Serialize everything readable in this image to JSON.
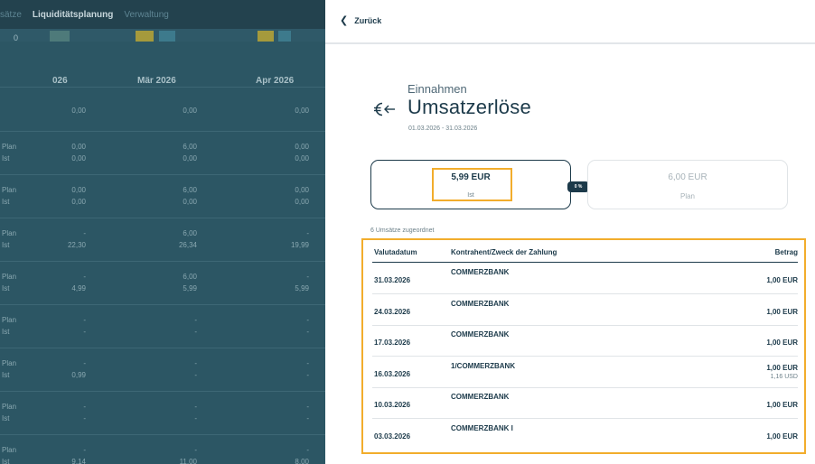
{
  "left": {
    "tabs": [
      "sätze",
      "Liquiditätsplanung",
      "Verwaltung"
    ],
    "active_tab": "Liquiditätsplanung",
    "zero_label": "0",
    "months": [
      "026",
      "Mär 2026",
      "Apr 2026"
    ],
    "first_row": [
      "0,00",
      "0,00",
      "0,00"
    ],
    "groups": [
      {
        "plan": [
          "0,00",
          "6,00",
          "0,00"
        ],
        "ist": [
          "0,00",
          "0,00",
          "0,00"
        ]
      },
      {
        "plan": [
          "0,00",
          "6,00",
          "0,00"
        ],
        "ist": [
          "0,00",
          "0,00",
          "0,00"
        ]
      },
      {
        "plan": [
          "-",
          "6,00",
          "-"
        ],
        "ist": [
          "22,30",
          "26,34",
          "19,99"
        ]
      },
      {
        "plan": [
          "-",
          "6,00",
          "-"
        ],
        "ist": [
          "4,99",
          "5,99",
          "5,99"
        ]
      },
      {
        "plan": [
          "-",
          "-",
          "-"
        ],
        "ist": [
          "-",
          "-",
          "-"
        ]
      },
      {
        "plan": [
          "-",
          "-",
          "-"
        ],
        "ist": [
          "0,99",
          "-",
          "-"
        ]
      },
      {
        "plan": [
          "-",
          "-",
          "-"
        ],
        "ist": [
          "-",
          "-",
          "-"
        ]
      },
      {
        "plan": [
          "-",
          "-",
          "-"
        ],
        "ist": [
          "9,14",
          "11,00",
          "8,00"
        ]
      }
    ],
    "plan_label": "Plan",
    "ist_label": "Ist"
  },
  "panel": {
    "back_label": "Zurück",
    "category": "Einnahmen",
    "title": "Umsatzerlöse",
    "date_range": "01.03.2026 - 31.03.2026",
    "ist_card": {
      "amount": "5,99 EUR",
      "label": "Ist"
    },
    "plan_card": {
      "amount": "6,00 EUR",
      "label": "Plan"
    },
    "percent_badge": "0 %",
    "assigned_text": "6 Umsätze zugeordnet",
    "table": {
      "headers": {
        "date": "Valutadatum",
        "party": "Kontrahent/Zweck der Zahlung",
        "amount": "Betrag"
      },
      "rows": [
        {
          "date": "31.03.2026",
          "party": "COMMERZBANK",
          "amount": "1,00 EUR",
          "amount2": ""
        },
        {
          "date": "24.03.2026",
          "party": "COMMERZBANK",
          "amount": "1,00 EUR",
          "amount2": ""
        },
        {
          "date": "17.03.2026",
          "party": "COMMERZBANK",
          "amount": "1,00 EUR",
          "amount2": ""
        },
        {
          "date": "16.03.2026",
          "party": "1/COMMERZBANK",
          "amount": "1,00 EUR",
          "amount2": "1,16 USD"
        },
        {
          "date": "10.03.2026",
          "party": "COMMERZBANK",
          "amount": "1,00 EUR",
          "amount2": ""
        },
        {
          "date": "03.03.2026",
          "party": "COMMERZBANK I",
          "amount": "1,00 EUR",
          "amount2": ""
        }
      ]
    }
  },
  "colors": {
    "accent_highlight": "#f2ad2c",
    "primary_dark": "#1c3a4a",
    "overlay": "#2c5664"
  },
  "icons": {
    "back": "chevron-left-icon",
    "category": "euro-arrow-icon"
  }
}
